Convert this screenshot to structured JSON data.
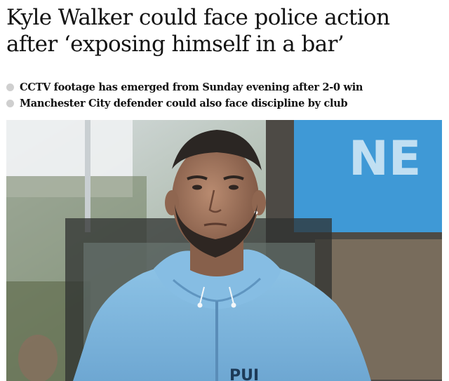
{
  "article": {
    "headline_line1": "Kyle Walker could face police action",
    "headline_line2": "after ‘exposing himself in a bar’",
    "standfirst": [
      "CCTV footage has emerged from Sunday evening after 2-0 win",
      "Manchester City defender could also face discipline by club"
    ],
    "photo": {
      "sign_text": "NE",
      "jersey_text": "PUI"
    }
  },
  "colors": {
    "text": "#121212",
    "bullet": "#cfcfcf",
    "hoodie": "#7fb5dc",
    "sign": "#3f99d6"
  }
}
